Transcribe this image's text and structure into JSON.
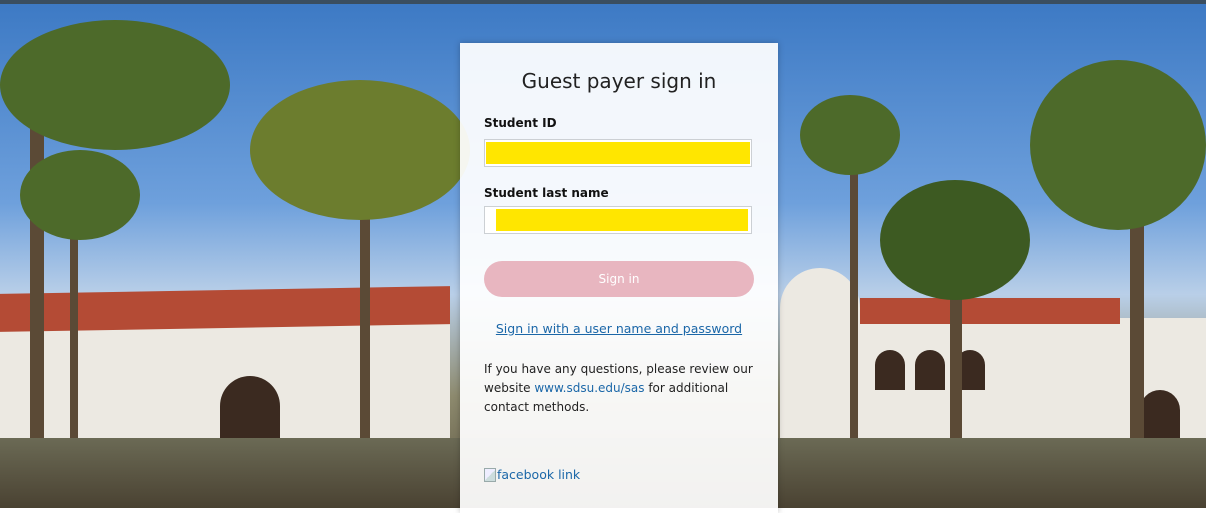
{
  "form": {
    "title": "Guest payer sign in",
    "student_id_label": "Student ID",
    "last_name_label": "Student last name",
    "sign_in_button": "Sign in",
    "alt_signin_link": "Sign in with a user name and password",
    "help_text_before": "If you have any questions, please review our website ",
    "help_link": "www.sdsu.edu/sas",
    "help_text_after": " for additional contact methods.",
    "facebook_alt": "facebook link"
  },
  "colors": {
    "redacted_fill": "#ffe600",
    "button_bg": "#e8b6c0",
    "link": "#1b67a8"
  }
}
